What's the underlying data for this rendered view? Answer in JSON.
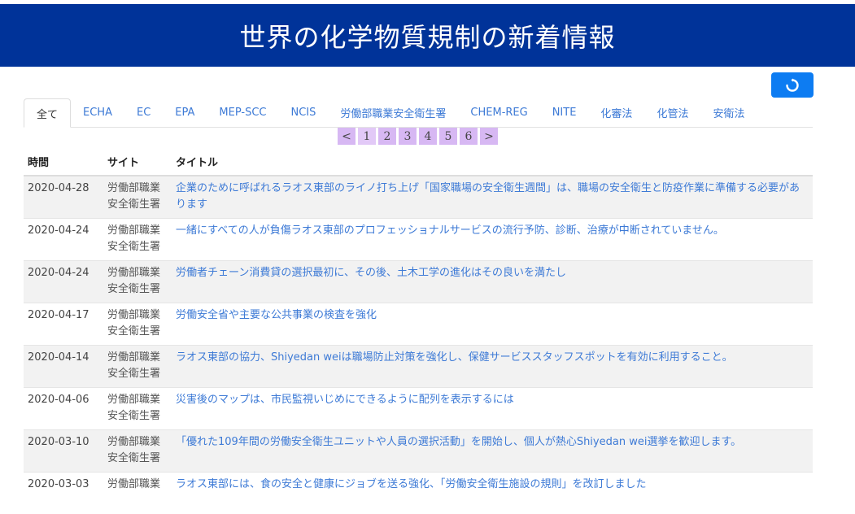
{
  "header": {
    "title": "世界の化学物質規制の新着情報"
  },
  "refresh": {
    "icon": "refresh-icon"
  },
  "tabs": [
    {
      "label": "全て",
      "active": true
    },
    {
      "label": "ECHA"
    },
    {
      "label": "EC"
    },
    {
      "label": "EPA"
    },
    {
      "label": "MEP-SCC"
    },
    {
      "label": "NCIS"
    },
    {
      "label": "労働部職業安全衛生署"
    },
    {
      "label": "CHEM-REG"
    },
    {
      "label": "NITE"
    },
    {
      "label": "化審法"
    },
    {
      "label": "化管法"
    },
    {
      "label": "安衛法"
    }
  ],
  "pager": {
    "prev": "<",
    "next": ">",
    "pages": [
      "1",
      "2",
      "3",
      "4",
      "5",
      "6"
    ],
    "current": "1"
  },
  "table": {
    "headers": {
      "date": "時間",
      "site": "サイト",
      "title": "タイトル"
    },
    "rows": [
      {
        "date": "2020-04-28",
        "site": "労働部職業安全衛生署",
        "title": "企業のために呼ばれるラオス東部のライノ打ち上げ「国家職場の安全衛生週間」は、職場の安全衛生と防疫作業に準備する必要があります"
      },
      {
        "date": "2020-04-24",
        "site": "労働部職業安全衛生署",
        "title": "一緒にすべての人が負傷ラオス東部のプロフェッショナルサービスの流行予防、診断、治療が中断されていません。"
      },
      {
        "date": "2020-04-24",
        "site": "労働部職業安全衛生署",
        "title": "労働者チェーン消費貸の選択最初に、その後、土木工学の進化はその良いを満たし"
      },
      {
        "date": "2020-04-17",
        "site": "労働部職業安全衛生署",
        "title": "労働安全省や主要な公共事業の検査を強化"
      },
      {
        "date": "2020-04-14",
        "site": "労働部職業安全衛生署",
        "title": "ラオス東部の協力、Shiyedan weiは職場防止対策を強化し、保健サービススタッフスポットを有効に利用すること。"
      },
      {
        "date": "2020-04-06",
        "site": "労働部職業安全衛生署",
        "title": "災害後のマップは、市民監視いじめにできるように配列を表示するには"
      },
      {
        "date": "2020-03-10",
        "site": "労働部職業安全衛生署",
        "title": "「優れた109年間の労働安全衛生ユニットや人員の選択活動」を開始し、個人が熱心Shiyedan wei選挙を歓迎します。"
      },
      {
        "date": "2020-03-03",
        "site": "労働部職業",
        "title": "ラオス東部には、食の安全と健康にジョブを送る強化、「労働安全衛生施設の規則」を改訂しました"
      }
    ]
  }
}
